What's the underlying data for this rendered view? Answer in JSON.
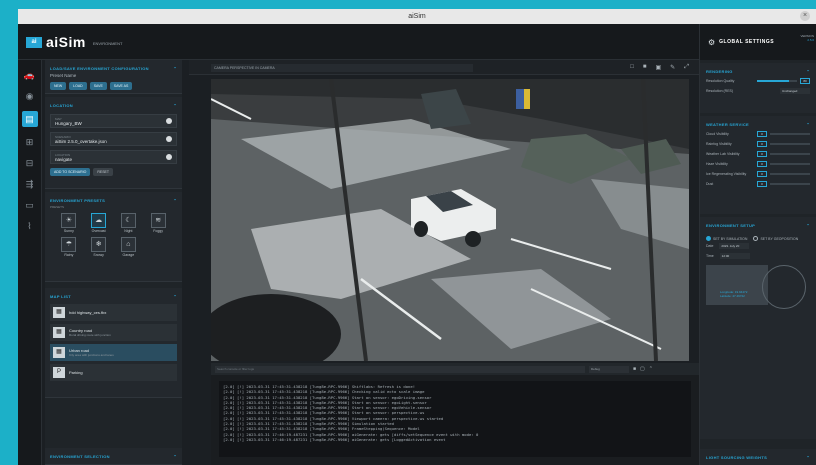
{
  "window": {
    "title": "aiSim"
  },
  "brand": {
    "mark": "ai",
    "name": "aiSim",
    "sub": "ENVIRONMENT"
  },
  "rail": {
    "icons": [
      "car-icon",
      "sensor-icon",
      "environment-icon",
      "scenario-icon",
      "map-icon",
      "route-icon",
      "console-icon",
      "chart-icon"
    ]
  },
  "left": {
    "config_header": "LOAD/SAVE ENVIRONMENT CONFIGURATION",
    "preset_label": "Preset Name",
    "config_buttons": [
      "NEW",
      "LOAD",
      "SAVE",
      "SAVE AS"
    ],
    "location_header": "LOCATION",
    "location_fields": [
      {
        "label": "MAP",
        "value": "Hungary_BW"
      },
      {
        "label": "SCENARIO",
        "value": "aiSim 2.5.0_overtake.json"
      },
      {
        "label": "LOCATION",
        "value": "navigate"
      }
    ],
    "location_buttons": [
      "ADD TO SCENARIO",
      "RESET"
    ],
    "presets_header": "ENVIRONMENT PRESETS",
    "presets_sub": "PRESETS",
    "presets": [
      {
        "label": "Sunny",
        "glyph": "☀"
      },
      {
        "label": "Overcast",
        "glyph": "☁"
      },
      {
        "label": "Night",
        "glyph": "☾"
      },
      {
        "label": "Foggy",
        "glyph": "≋"
      },
      {
        "label": "Rainy",
        "glyph": "☂"
      },
      {
        "label": "Snowy",
        "glyph": "❄"
      },
      {
        "label": "Garage",
        "glyph": "⌂"
      }
    ],
    "maplist_header": "MAP LIST",
    "maps": [
      {
        "title": "hdd highway_ces.fbx",
        "sub": ""
      },
      {
        "title": "Country road",
        "sub": "Rural driving route with junction"
      },
      {
        "title": "Urban road",
        "sub": "City area with junctions and lanes"
      },
      {
        "title": "Parking",
        "sub": ""
      }
    ],
    "bottom_header": "ENVIRONMENT SELECTION"
  },
  "viewport": {
    "camera": "CAMERA PERSPECTIVE IN CAMERA",
    "tools": [
      "□",
      "■",
      "▣",
      "✎",
      "⤢"
    ]
  },
  "console": {
    "search_placeholder": "Search console or filter logs",
    "filter": "Debug",
    "lines": [
      "[2.0] [!] 2023-03-31 17:45:31.438218 [Tung8e-RPC-9966] Shiftlabs: Refresh is done!",
      "[2.0] [!] 2023-03-31 17:45:31.438218 [Tung8e-RPC-9966] Checking valid ecto scale image",
      "[2.0] [!] 2023-03-31 17:45:31.438218 [Tung8e-RPC-9966] Start on sensor: egoDriving.sensor",
      "[2.0] [!] 2023-03-31 17:45:31.438218 [Tung8e-RPC-9966] Start on sensor: egoLight.sensor",
      "[2.0] [!] 2023-03-31 17:45:31.438218 [Tung8e-RPC-9966] Start on sensor: egoVehicle.sensor",
      "[2.0] [!] 2023-03-31 17:45:31.438218 [Tung8e-RPC-9966] Start on sensor: perspective.ws",
      "[2.0] [!] 2023-03-31 17:45:31.438218 [Tung8e-RPC-9966] Viewport camera: perspective.ws started",
      "[2.0] [!] 2023-03-31 17:45:31.438218 [Tung8e-RPC-9966] Simulation started",
      "[2.0] [!] 2023-03-31 17:45:31.438218 [Tung8e-RPC-9966] FrameStepping(Sequence: Model",
      "[2.0] [!] 2023-03-31 17:46:19.487231 [Tung8e-RPC-9966] aiGenerate: gets [diffs/setSequence event with mode: 0",
      "[2.0] [!] 2023-03-31 17:46:19.487231 [Tung8e-RPC-9966] aiGenerate: gets [LoggedActivation event"
    ]
  },
  "right": {
    "title": "GLOBAL SETTINGS",
    "version_label": "VERSION",
    "version_value": "2.5.0",
    "rendering_header": "RENDERING",
    "rendering": [
      {
        "label": "Resolution Quality",
        "value": "80",
        "fill": 0.8
      },
      {
        "label": "Resolution (RES)",
        "dropdown": "Unchanged"
      }
    ],
    "weather_header": "WEATHER SERVICE",
    "weather": [
      {
        "label": "Cloud Visibility",
        "value": "0",
        "fill": 0.0
      },
      {
        "label": "Rainfog Visibility",
        "value": "0",
        "fill": 0.0
      },
      {
        "label": "Weather Lab Visibility",
        "value": "0",
        "fill": 0.0
      },
      {
        "label": "Haze Visibility",
        "value": "0",
        "fill": 0.0
      },
      {
        "label": "Ice Regenerating Visibility",
        "value": "0",
        "fill": 0.0
      },
      {
        "label": "Dust",
        "value": "0",
        "fill": 0.0
      }
    ],
    "env_header": "ENVIRONMENT SETUP",
    "env_radio": [
      "SET BY SIMULATION",
      "SET BY GEOPOSITION"
    ],
    "env_rows": [
      {
        "label": "Date",
        "value": "2023. July 20"
      },
      {
        "label": "Time",
        "value": "12:00"
      }
    ],
    "map_info": [
      "Longitude: 19.94472",
      "Latitude: 47.49722"
    ],
    "bottom_header": "LIGHT SOURCING WEIGHTS"
  }
}
